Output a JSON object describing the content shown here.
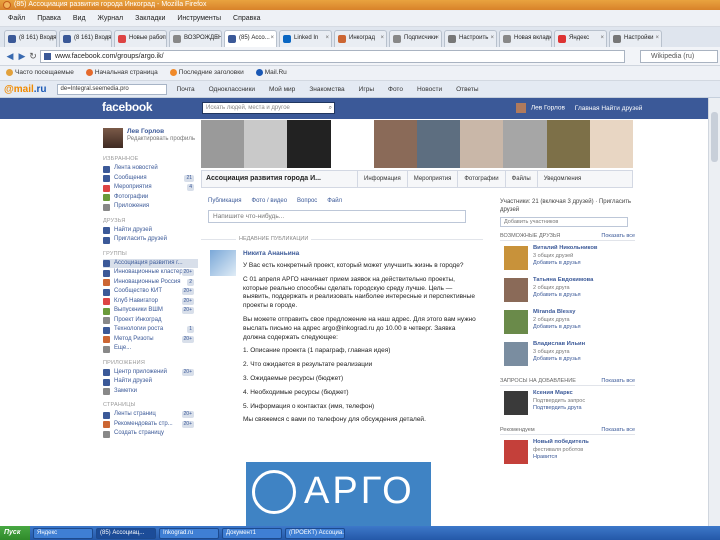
{
  "window": {
    "title": "(85) Ассоциация развития города Инкоград - Mozilla Firefox"
  },
  "menu": [
    "Файл",
    "Правка",
    "Вид",
    "Журнал",
    "Закладки",
    "Инструменты",
    "Справка"
  ],
  "tabs": [
    {
      "label": "(8 161) Входящие",
      "color": "#3b5998"
    },
    {
      "label": "(8 161) Входящие",
      "color": "#3b5998"
    },
    {
      "label": "Новые работы",
      "color": "#d44"
    },
    {
      "label": "ВОЗРОЖДЕНИЕ",
      "color": "#888"
    },
    {
      "label": "(85) Ассо...",
      "color": "#3b5998",
      "active": true
    },
    {
      "label": "Linked In",
      "color": "#0a66c2"
    },
    {
      "label": "Инкоград",
      "color": "#c63"
    },
    {
      "label": "Подписчики",
      "color": "#888"
    },
    {
      "label": "Настроить",
      "color": "#777"
    },
    {
      "label": "Новая вкладка",
      "color": "#888"
    },
    {
      "label": "Яндекс",
      "color": "#d33"
    },
    {
      "label": "Настройки",
      "color": "#777"
    }
  ],
  "nav": {
    "url": "www.facebook.com/groups/argo.ik/",
    "search_placeholder": "Wikipedia (ru)"
  },
  "bookmarks": [
    {
      "label": "Часто посещаемые",
      "color": "#e2a13c"
    },
    {
      "label": "Начальная страница",
      "color": "#e56a2c"
    },
    {
      "label": "Последние заголовки",
      "color": "#f08a2a"
    },
    {
      "label": "Mail.Ru",
      "color": "#1a58b5"
    }
  ],
  "mailru": {
    "brand": "@mail",
    "brand_suffix": ".ru",
    "search_text": "de=Integral.seemedia.pro",
    "items": [
      "Почта",
      "Одноклассники",
      "Мой мир",
      "Знакомства",
      "Игры",
      "Фото",
      "Новости",
      "Ответы"
    ]
  },
  "facebook": {
    "logo": "facebook",
    "search_placeholder": "Искать людей, места и другое",
    "user_name": "Лев Горлов",
    "header_links": "Главная  Найти друзей"
  },
  "left": {
    "profile_name": "Лев Горлов",
    "profile_edit": "Редактировать профиль",
    "favorites_title": "ИЗБРАННОЕ",
    "favorites": [
      {
        "label": "Лента новостей",
        "color": "#3b5998"
      },
      {
        "label": "Сообщения",
        "color": "#3b5998",
        "count": "21"
      },
      {
        "label": "Мероприятия",
        "color": "#d44",
        "count": "4"
      },
      {
        "label": "Фотографии",
        "color": "#6a9a3a"
      },
      {
        "label": "Приложения",
        "color": "#888"
      }
    ],
    "friends_title": "ДРУЗЬЯ",
    "friends": [
      {
        "label": "Найти друзей",
        "color": "#3b5998"
      },
      {
        "label": "Пригласить друзей",
        "color": "#3b5998"
      }
    ],
    "groups_title": "ГРУППЫ",
    "groups": [
      {
        "label": "Ассоциация развития г...",
        "color": "#3b5998",
        "selected": true
      },
      {
        "label": "Инновационные кластеры",
        "color": "#3b5998",
        "count": "20+"
      },
      {
        "label": "Инновационные Россия",
        "color": "#c63",
        "count": "2"
      },
      {
        "label": "Сообщество КИТ",
        "color": "#3b5998",
        "count": "20+"
      },
      {
        "label": "Клуб Навигатор",
        "color": "#d44",
        "count": "20+"
      },
      {
        "label": "Выпускники ВШМ",
        "color": "#6a9a3a",
        "count": "20+"
      },
      {
        "label": "Проект Инкоград",
        "color": "#888"
      },
      {
        "label": "Технологии роста",
        "color": "#3b5998",
        "count": "1"
      },
      {
        "label": "Метод Ризоты",
        "color": "#c63",
        "count": "20+"
      },
      {
        "label": "Еще...",
        "color": "#888"
      }
    ],
    "apps_title": "ПРИЛОЖЕНИЯ",
    "apps": [
      {
        "label": "Центр приложений",
        "color": "#3b5998",
        "count": "20+"
      },
      {
        "label": "Найти друзей",
        "color": "#3b5998"
      },
      {
        "label": "Заметки",
        "color": "#888"
      }
    ],
    "pages_title": "СТРАНИЦЫ",
    "pages": [
      {
        "label": "Ленты страниц",
        "color": "#3b5998",
        "count": "20+"
      },
      {
        "label": "Рекомендовать стр...",
        "color": "#c63",
        "count": "20+"
      },
      {
        "label": "Создать страницу",
        "color": "#888"
      }
    ]
  },
  "group": {
    "name": "Ассоциация развития города И...",
    "tabs": [
      "Информация",
      "Мероприятия",
      "Фотографии",
      "Файлы",
      "Уведомления"
    ],
    "cover_colors": [
      "#9a9a9a",
      "#c9c9c9",
      "#222222",
      "#ffffff",
      "#8a6a58",
      "#5d6e80",
      "#c9b7a8",
      "#a6a6a6",
      "#7d7048",
      "#e8d6c3"
    ]
  },
  "composer": {
    "tabs": [
      "Публикация",
      "Фото / видео",
      "Вопрос",
      "Файл"
    ],
    "placeholder": "Напишите что-нибудь...",
    "sort_label": "НЕДАВНИЕ ПУБЛИКАЦИИ"
  },
  "post": {
    "author": "Никита Ананьина",
    "paragraphs": [
      "У Вас есть конкретный проект, который может улучшить жизнь в городе?",
      "С 01 апреля АРГО начинает прием заявок на действительно проекты, которые реально способны сделать городскую среду лучше. Цель — выявить, поддержать и реализовать наиболее интересные и перспективные проекты в городе.",
      "Вы можете отправить свое предложение на наш адрес. Для этого вам нужно выслать письмо на адрес argo@inkograd.ru до 10.00 в четверг. Заявка должна содержать следующее:",
      "1. Описание проекта (1 параграф, главная идея)",
      "2. Что ожидается в результате реализации",
      "3. Ожидаемые ресурсы (бюджет)",
      "4. Необходимые ресурсы (бюджет)",
      "5. Информация о контактах (имя, телефон)",
      "Мы свяжемся с вами по телефону для обсуждения деталей."
    ],
    "image_text": "АРГО"
  },
  "right": {
    "members_text": "Участники: 21 (включая 3 друзей) · Пригласить друзей",
    "add_placeholder": "Добавить участников",
    "sugg_title": "ВОЗМОЖНЫЕ ДРУЗЬЯ",
    "sugg_link": "Показать все",
    "suggestions": [
      {
        "name": "Виталий Никольников",
        "mutual": "3 общих друзей",
        "action": "Добавить в друзья",
        "color": "#c8923a"
      },
      {
        "name": "Татьяна Евдокимова",
        "mutual": "2 общих друга",
        "action": "Добавить в друзья",
        "color": "#8a6a58"
      },
      {
        "name": "Miranda Blessy",
        "mutual": "2 общих друга",
        "action": "Добавить в друзья",
        "color": "#6a8a4a"
      },
      {
        "name": "Владислав Ильин",
        "mutual": "3 общих друга",
        "action": "Добавить в друзья",
        "color": "#7a8da0"
      }
    ],
    "requests_title": "ЗАПРОСЫ НА ДОБАВЛЕНИЕ",
    "requests_link": "Показать все",
    "request": {
      "name": "Ксения Маркс",
      "mutual": "Подтвердить запрос",
      "action": "Подтвердить друга",
      "color": "#3a3a3a"
    },
    "recommended_title": "Рекомендуем",
    "recommended_link": "Показать все",
    "recommended": {
      "name": "Новый победитель",
      "mutual": "фестиваля роботов",
      "action": "Нравится",
      "color": "#c4403a"
    }
  },
  "taskbar": {
    "start": "Пуск",
    "tasks": [
      "Яндекс",
      "(85) Ассоциац...",
      "Inkograd.ru",
      "Документ1",
      "(ПРОЕКТ) Ассоциа..."
    ]
  }
}
